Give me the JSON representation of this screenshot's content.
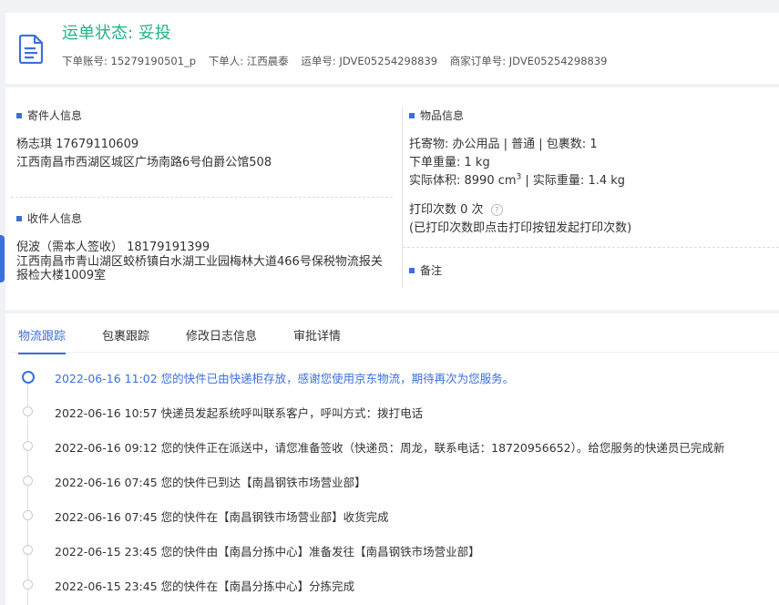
{
  "header": {
    "status_title": "运单状态: 妥投",
    "account": "下单账号: 15279190501_p",
    "orderer": "下单人: 江西晨泰",
    "waybill": "运单号: JDVE05254298839",
    "merchant_order": "商家订单号: JDVE05254298839"
  },
  "sender": {
    "section_title": "寄件人信息",
    "name_phone": "杨志琪    17679110609",
    "address": "江西南昌市西湖区城区广场南路6号伯爵公馆508"
  },
  "receiver": {
    "section_title": "收件人信息",
    "name_phone": "倪波（需本人签收）   18179191399",
    "address": "江西南昌市青山湖区蛟桥镇白水湖工业园梅林大道466号保税物流报关报检大楼1009室"
  },
  "goods": {
    "section_title": "物品信息",
    "line1": "托寄物:  办公用品 | 普通  |  包裹数:  1",
    "line2": "下单重量:  1 kg",
    "volume_prefix": "实际体积:   8990 cm",
    "volume_sup": "3",
    "volume_suffix": " |  实际重量:   1.4 kg",
    "print_count": "打印次数    0 次",
    "print_note": "(已打印次数即点击打印按钮发起打印次数)"
  },
  "remarks": {
    "section_title": "备注"
  },
  "tabs": [
    {
      "label": "物流跟踪"
    },
    {
      "label": "包裹跟踪"
    },
    {
      "label": "修改日志信息"
    },
    {
      "label": "审批详情"
    }
  ],
  "events": [
    {
      "text": "2022-06-16 11:02 您的快件已由快递柜存放，感谢您使用京东物流，期待再次为您服务。"
    },
    {
      "text": "2022-06-16 10:57 快递员发起系统呼叫联系客户，呼叫方式：拨打电话"
    },
    {
      "text": "2022-06-16 09:12 您的快件正在派送中，请您准备签收（快递员：周龙，联系电话：18720956652）。给您服务的快递员已完成新"
    },
    {
      "text": "2022-06-16 07:45 您的快件已到达【南昌钢铁市场营业部】"
    },
    {
      "text": "2022-06-16 07:45 您的快件在【南昌钢铁市场营业部】收货完成"
    },
    {
      "text": "2022-06-15 23:45 您的快件由【南昌分拣中心】准备发往【南昌钢铁市场营业部】"
    },
    {
      "text": "2022-06-15 23:45 您的快件在【南昌分拣中心】分拣完成"
    }
  ],
  "colors": {
    "accent": "#3a6fe0",
    "status_green": "#1fb589"
  }
}
